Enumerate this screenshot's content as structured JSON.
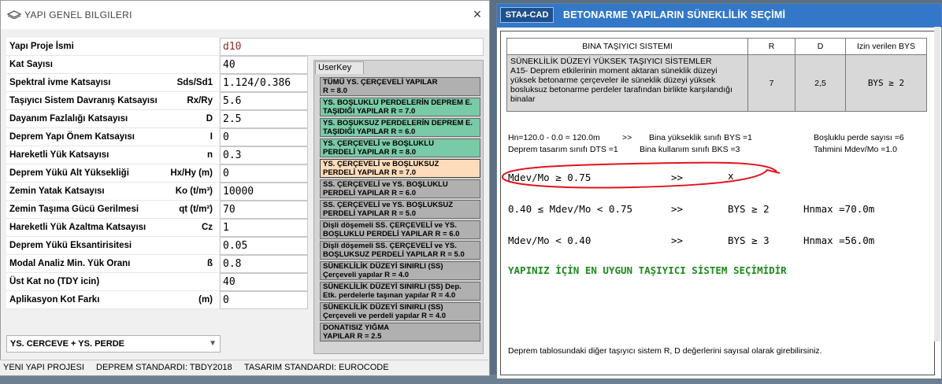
{
  "left_window": {
    "title": "YAPI GENEL BILGILERI",
    "close_label": "×",
    "form": [
      {
        "label": "Yapı Proje İsmi",
        "unit": "",
        "value": "d10"
      },
      {
        "label": "Kat Sayısı",
        "unit": "",
        "value": "40"
      },
      {
        "label": "Spektral ivme Katsayısı",
        "unit": "Sds/Sd1",
        "value": "1.124/0.386"
      },
      {
        "label": "Taşıyıcı Sistem Davranış Katsayısı",
        "unit": "Rx/Ry",
        "value": "5.6"
      },
      {
        "label": "Dayanım Fazlalığı Katsayısı",
        "unit": "D",
        "value": "2.5"
      },
      {
        "label": "Deprem Yapı Önem Katsayısı",
        "unit": "I",
        "value": "0"
      },
      {
        "label": "Hareketli Yük Katsayısı",
        "unit": "n",
        "value": "0.3"
      },
      {
        "label": "Deprem Yükü Alt Yüksekliği",
        "unit": "Hx/Hy  (m)",
        "value": "0"
      },
      {
        "label": "Zemin Yatak Katsayısı",
        "unit": "Ko  (t/m³)",
        "value": "10000"
      },
      {
        "label": "Zemin Taşıma Gücü Gerilmesi",
        "unit": "qt  (t/m²)",
        "value": "70"
      },
      {
        "label": "Hareketli Yük Azaltma Katsayısı",
        "unit": "Cz",
        "value": "1"
      },
      {
        "label": "Deprem Yükü Eksantirisitesi",
        "unit": "",
        "value": "0.05"
      },
      {
        "label": "Modal Analiz Min. Yük Oranı",
        "unit": "ß",
        "value": "0.8"
      },
      {
        "label": "Üst Kat no (TDY icin)",
        "unit": "",
        "value": "40"
      },
      {
        "label": "Aplikasyon Kot Farkı",
        "unit": "(m)",
        "value": "0"
      }
    ],
    "userkey_tab": "UserKey",
    "userkey_buttons": [
      {
        "line1": "TÜMÜ YS. ÇERÇEVELİ YAPILAR",
        "line2": "R = 8.0",
        "style": "gray"
      },
      {
        "line1": "YS. BOŞLUKLU PERDELERİN DEPREM E.",
        "line2": "TAŞIDIĞI YAPILAR        R = 7.0",
        "style": "green"
      },
      {
        "line1": "YS. BOŞUKSUZ PERDELERİN DEPREM E.",
        "line2": "TAŞIDIĞI YAPILAR        R = 6.0",
        "style": "green"
      },
      {
        "line1": "YS. ÇERÇEVELİ ve BOŞLUKLU",
        "line2": "PERDELİ YAPILAR      R = 8.0",
        "style": "green"
      },
      {
        "line1": "YS. ÇERÇEVELİ ve BOŞLUKSUZ",
        "line2": "PERDELİ YAPILAR      R = 7.0",
        "style": "selected"
      },
      {
        "line1": "SS. ÇERÇEVELİ ve YS. BOŞLUKLU",
        "line2": "PERDELİ YAPILAR      R = 6.0",
        "style": "gray"
      },
      {
        "line1": "SS. ÇERÇEVELİ ve YS. BOŞLUKSUZ",
        "line2": "PERDELİ YAPILAR      R = 5.0",
        "style": "gray"
      },
      {
        "line1": "Dişli döşemeli SS. ÇERÇEVELİ ve YS.",
        "line2": "BOŞLUKLU PERDELİ YAPILAR  R = 6.0",
        "style": "gray"
      },
      {
        "line1": "Dişli döşemeli SS. ÇERÇEVELİ ve YS.",
        "line2": "BOŞLUKSUZ PERDELİ YAPILAR  R = 5.0",
        "style": "gray"
      },
      {
        "line1": "SÜNEKLİLİK DÜZEYİ SINIRLI (SS)",
        "line2": "Çerçeveli yapılar R = 4.0",
        "style": "gray"
      },
      {
        "line1": "SÜNEKLİLİK DÜZEYİ SINIRLI (SS) Dep.",
        "line2": "Etk. perdelerle taşınan yapılar R = 4.0",
        "style": "gray"
      },
      {
        "line1": "SÜNEKLİLİK DÜZEYİ SINIRLI (SS)",
        "line2": "Çerçeveli ve perdeli yapılar R = 4.0",
        "style": "gray"
      },
      {
        "line1": "DONATISIZ YIĞMA",
        "line2": "YAPILAR  R = 2.5",
        "style": "gray"
      }
    ],
    "select_value": "YS. CERCEVE + YS. PERDE",
    "status": {
      "project": "YENI YAPI PROJESI",
      "earthquake": "DEPREM STANDARDI: TBDY2018",
      "design": "TASARIM STANDARDI: EUROCODE"
    }
  },
  "right_window": {
    "badge": "STA4-CAD",
    "title": "BETONARME YAPILARIN SÜNEKLİLİK SEÇİMİ",
    "table": {
      "headers": [
        "BINA TAŞIYICI SISTEMI",
        "R",
        "D",
        "Izin verilen BYS"
      ],
      "desc_title": "SÜNEKLİLİK DÜZEYİ YÜKSEK TAŞIYICI SİSTEMLER",
      "desc_body": "A15- Deprem etkilerinin moment aktaran süneklik düzeyi yüksek betonarme çerçeveler ile süneklik düzeyi yüksek bosluksuz betonarme perdeler tarafından birlikte karşılandığı binalar",
      "r": "7",
      "d": "2,5",
      "bys": "BYS  ≥  2"
    },
    "info": {
      "hn": "Hn=120.0 - 0.0 = 120.0m",
      "arrow1": ">>",
      "height_class": "Bina yükseklik sınıfı    BYS =1",
      "perde": "Boşluklu perde sayısı =6",
      "dts": "Deprem tasarım sınıfı   DTS =1",
      "bks": "Bina kullanım  sınıfı    BKS =3",
      "mdev": "Tahmini   Mdev/Mo =1.0"
    },
    "rows": [
      {
        "cond": "Mdev/Mo ≥ 0.75",
        "arrow": ">>",
        "result": "x",
        "hn": ""
      },
      {
        "cond": "0.40 ≤ Mdev/Mo <  0.75",
        "arrow": ">>",
        "result": "BYS  ≥  2",
        "hn": "Hnmax =70.0m"
      },
      {
        "cond": "Mdev/Mo <  0.40",
        "arrow": ">>",
        "result": "BYS  ≥  3",
        "hn": "Hnmax =56.0m"
      }
    ],
    "green_msg": "YAPINIZ İÇİN EN UYGUN TAŞIYICI SİSTEM SEÇİMİDİR",
    "footnote": "Deprem tablosundaki diğer taşıyıcı sistem R, D değerlerini sayısal olarak girebilirsiniz.",
    "highlight_color": "#e0141e"
  }
}
